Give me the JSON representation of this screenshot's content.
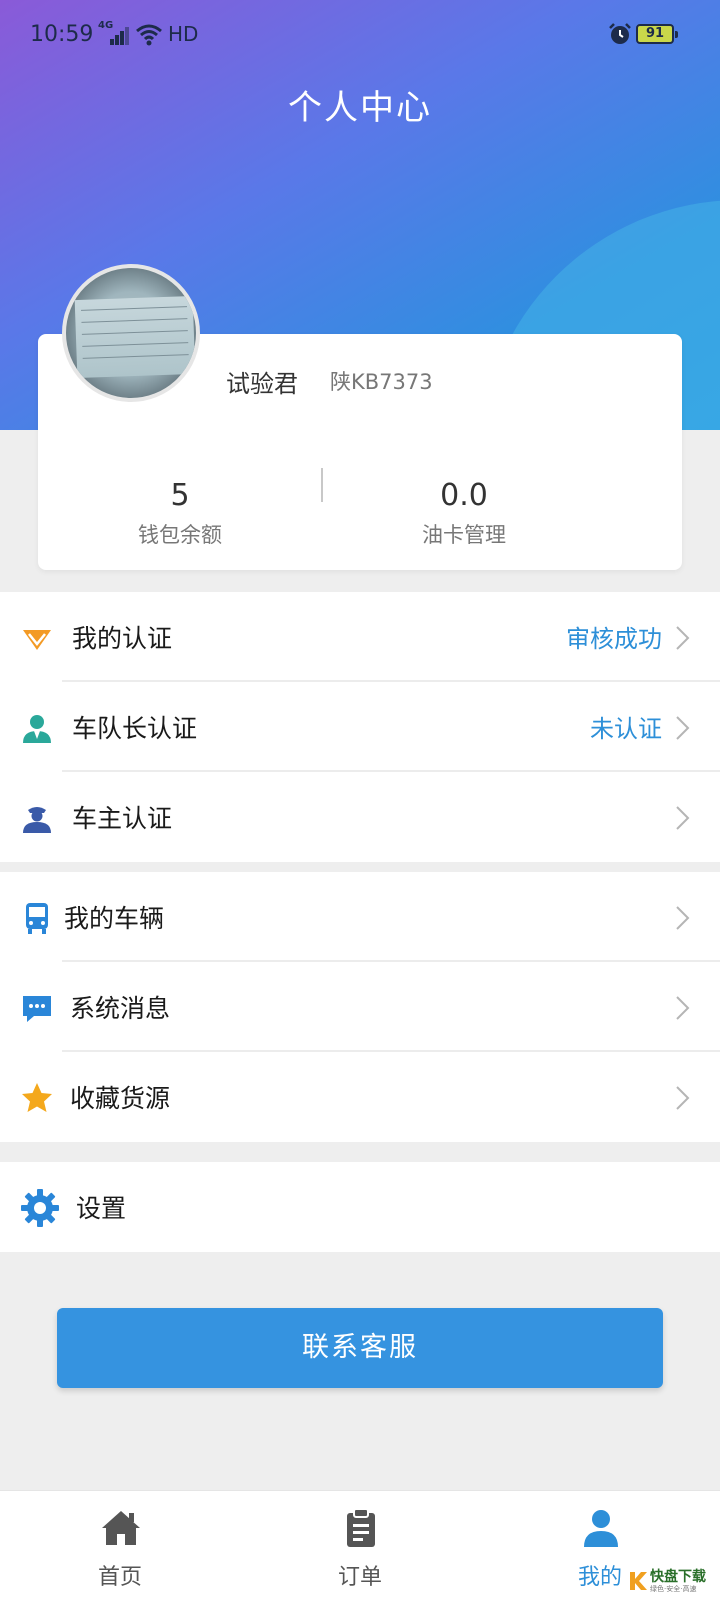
{
  "status_bar": {
    "time": "10:59",
    "network": "4G",
    "wifi_label": "HD",
    "battery": "91"
  },
  "header": {
    "title": "个人中心"
  },
  "profile": {
    "name": "试验君",
    "plate": "陕KB7373",
    "stats": [
      {
        "value": "5",
        "label": "钱包余额"
      },
      {
        "value": "0.0",
        "label": "油卡管理"
      }
    ]
  },
  "menu": {
    "certification": {
      "label": "我的认证",
      "value": "审核成功"
    },
    "captain": {
      "label": "车队长认证",
      "value": "未认证"
    },
    "owner": {
      "label": "车主认证"
    },
    "vehicles": {
      "label": "我的车辆"
    },
    "messages": {
      "label": "系统消息"
    },
    "favorites": {
      "label": "收藏货源"
    },
    "settings": {
      "label": "设置"
    }
  },
  "contact_button": "联系客服",
  "tabs": [
    {
      "label": "首页",
      "icon": "home-icon"
    },
    {
      "label": "订单",
      "icon": "clipboard-icon"
    },
    {
      "label": "我的",
      "icon": "user-icon",
      "active": true
    }
  ],
  "watermark": {
    "brand": "快盘下载",
    "tagline": "绿色·安全·高速"
  },
  "colors": {
    "accent": "#2d8fd8",
    "button": "#3593e0",
    "header_start": "#8a5ad8",
    "header_end": "#2a96e2"
  }
}
